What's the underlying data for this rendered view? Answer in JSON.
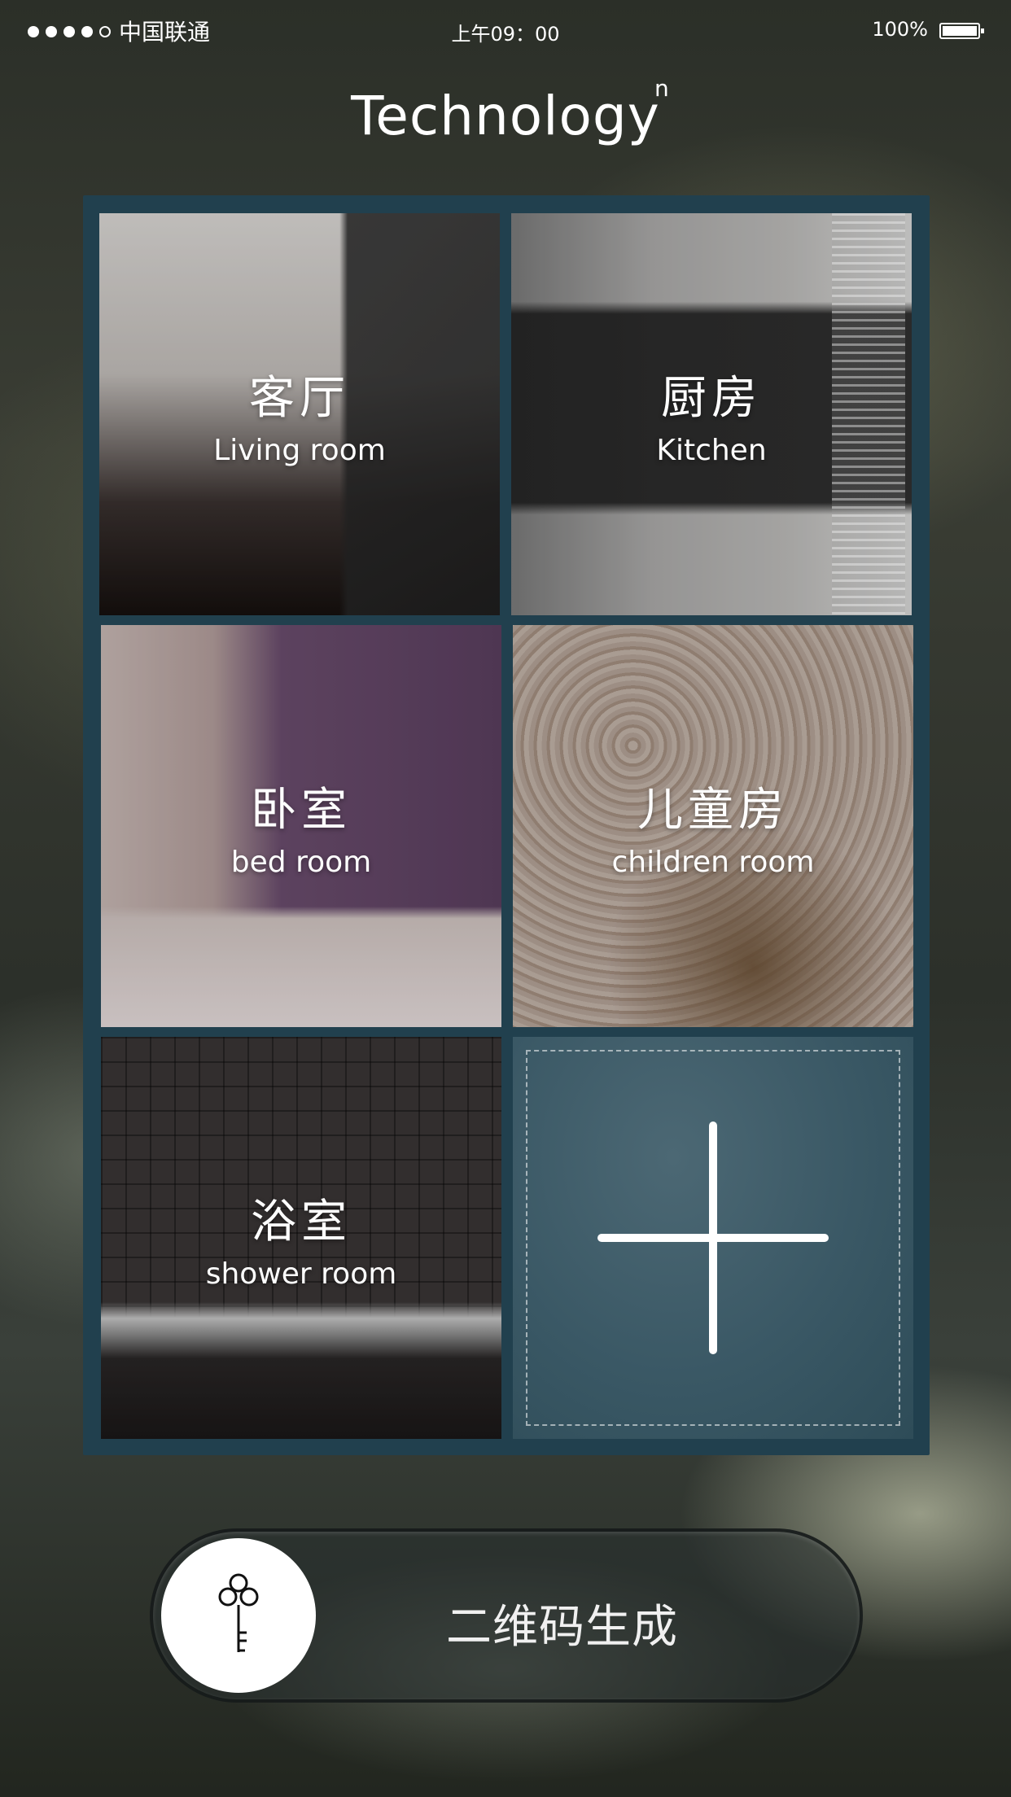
{
  "status_bar": {
    "carrier": "中国联通",
    "time": "上午09：00",
    "battery": "100%"
  },
  "header": {
    "title": "Technology",
    "superscript": "n"
  },
  "rooms": [
    {
      "zh": "客厅",
      "en": "Living room"
    },
    {
      "zh": "厨房",
      "en": "Kitchen"
    },
    {
      "zh": "卧室",
      "en": "bed room"
    },
    {
      "zh": "儿童房",
      "en": "children room"
    },
    {
      "zh": "浴室",
      "en": "shower room"
    }
  ],
  "add_tile": {
    "icon": "plus-icon"
  },
  "action": {
    "label": "二维码生成",
    "icon": "key-icon"
  }
}
